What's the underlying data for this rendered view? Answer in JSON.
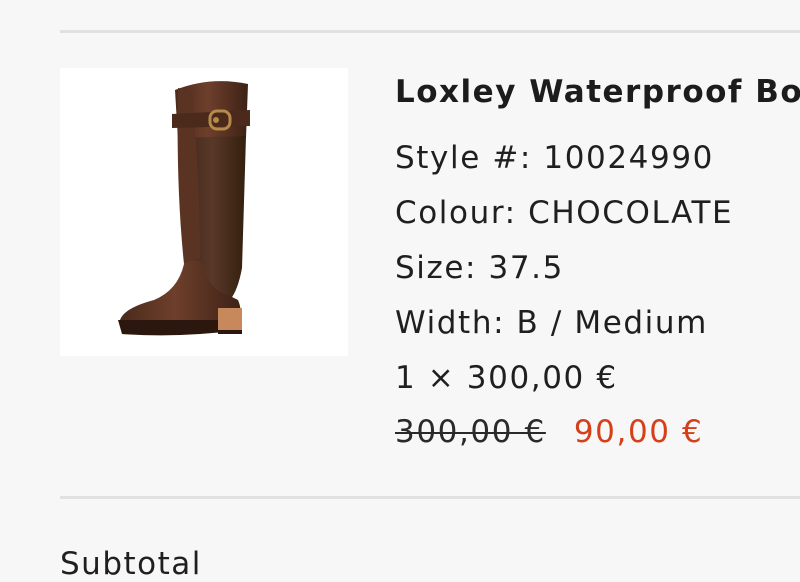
{
  "product": {
    "image_icon": "boot-product-image",
    "title": "Loxley Waterproof Boot",
    "style": "Style #: 10024990",
    "colour": "Colour: CHOCOLATE",
    "size": "Size: 37.5",
    "width": "Width: B / Medium",
    "quantity_line": "1 × 300,00 €",
    "original_price": "300,00 €",
    "sale_price": "90,00 €"
  },
  "summary": {
    "subtotal_label": "Subtotal"
  },
  "colors": {
    "sale": "#d5401b",
    "divider": "#e1e1e1",
    "background": "#f7f7f7"
  }
}
